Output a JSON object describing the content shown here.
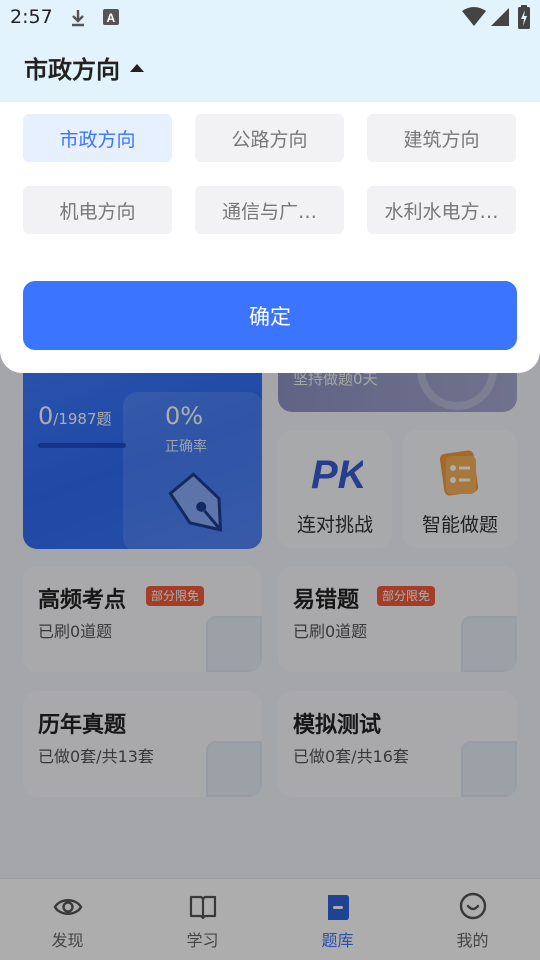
{
  "status_bar": {
    "time": "2:57"
  },
  "selector": {
    "current": "市政方向"
  },
  "options": [
    {
      "label": "市政方向",
      "selected": true
    },
    {
      "label": "公路方向",
      "selected": false
    },
    {
      "label": "建筑方向",
      "selected": false
    },
    {
      "label": "机电方向",
      "selected": false
    },
    {
      "label": "通信与广…",
      "selected": false
    },
    {
      "label": "水利水电方…",
      "selected": false
    }
  ],
  "confirm_label": "确定",
  "practice": {
    "done": "0",
    "total": "/1987题",
    "rate": "0%",
    "rate_label": "正确率",
    "progress": 0
  },
  "streak": {
    "text": "坚持做题0天"
  },
  "modes": [
    {
      "label": "连对挑战",
      "icon": "pk-icon"
    },
    {
      "label": "智能做题",
      "icon": "checklist-icon"
    }
  ],
  "features": [
    {
      "title": "高频考点",
      "badge": "部分限免",
      "sub": "已刷0道题",
      "icon": "trend-chart-icon"
    },
    {
      "title": "易错题",
      "badge": "部分限免",
      "sub": "已刷0道题",
      "icon": "mistake-x-icon"
    },
    {
      "title": "历年真题",
      "badge": "",
      "sub": "已做0套/共13套",
      "icon": "paper-icon"
    },
    {
      "title": "模拟测试",
      "badge": "",
      "sub": "已做0套/共16套",
      "icon": "edit-icon"
    }
  ],
  "nav": [
    {
      "label": "发现",
      "icon": "discover-icon",
      "active": false
    },
    {
      "label": "学习",
      "icon": "book-icon",
      "active": false
    },
    {
      "label": "题库",
      "icon": "question-bank-icon",
      "active": true
    },
    {
      "label": "我的",
      "icon": "profile-icon",
      "active": false
    }
  ],
  "colors": {
    "accent": "#3b74ff",
    "badge": "#ef5a3c",
    "header_bg": "#e3f3fc"
  }
}
